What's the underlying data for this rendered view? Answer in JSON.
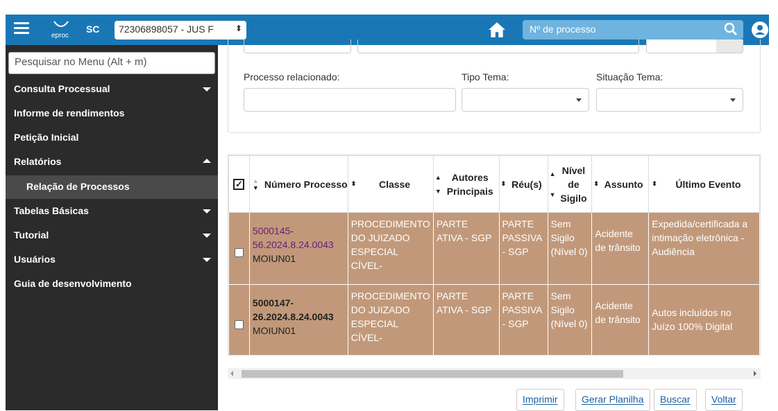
{
  "header": {
    "logo_text": "eproc",
    "uf": "SC",
    "unit_selected": "72306898057 - JUS F",
    "search_placeholder": "Nº de processo",
    "colors": {
      "bar": "#1a77b6",
      "search_bg": "#6fb3df"
    }
  },
  "sidebar": {
    "search_placeholder": "Pesquisar no Menu (Alt + m)",
    "items": [
      {
        "label": "Consulta Processual",
        "arrow": "down"
      },
      {
        "label": "Informe de rendimentos"
      },
      {
        "label": "Petição Inicial"
      },
      {
        "label": "Relatórios",
        "arrow": "up"
      },
      {
        "label": "Relação de Processos",
        "sub": true
      },
      {
        "label": "Tabelas Básicas",
        "arrow": "down"
      },
      {
        "label": "Tutorial",
        "arrow": "down"
      },
      {
        "label": "Usuários",
        "arrow": "down"
      },
      {
        "label": "Guia de desenvolvimento"
      }
    ]
  },
  "filters": {
    "processo_relacionado_label": "Processo relacionado:",
    "tipo_tema_label": "Tipo Tema:",
    "situacao_tema_label": "Situação Tema:"
  },
  "table": {
    "headers": {
      "numero_processo": "Número Processo",
      "classe": "Classe",
      "autores": "Autores Principais",
      "reus": "Réu(s)",
      "nivel_sigilo": "Nível de Sigilo",
      "assunto": "Assunto",
      "ultimo_evento": "Último Evento"
    },
    "rows": [
      {
        "numero": "5000145-56.2024.8.24.0043",
        "orgao": "MOIUN01",
        "classe": "PROCEDIMENTO DO JUIZADO ESPECIAL CÍVEL-",
        "autores": "PARTE ATIVA - SGP",
        "reus": "PARTE PASSIVA - SGP",
        "sigilo": "Sem Sigilo (Nível 0)",
        "assunto": "Acidente de trânsito",
        "evento": "Expedida/certificada a intimação eletrônica - Audiência"
      },
      {
        "numero": "5000147-26.2024.8.24.0043",
        "orgao": "MOIUN01",
        "classe": "PROCEDIMENTO DO JUIZADO ESPECIAL CÍVEL-",
        "autores": "PARTE ATIVA - SGP",
        "reus": "PARTE PASSIVA - SGP",
        "sigilo": "Sem Sigilo (Nível 0)",
        "assunto": "Acidente de trânsito",
        "evento": "Autos incluídos no Juízo 100% Digital"
      }
    ],
    "row_color": "#c1997a"
  },
  "actions": {
    "imprimir": "Imprimir",
    "gerar_planilha": "Gerar Planilha",
    "buscar": "Buscar",
    "voltar": "Voltar"
  }
}
